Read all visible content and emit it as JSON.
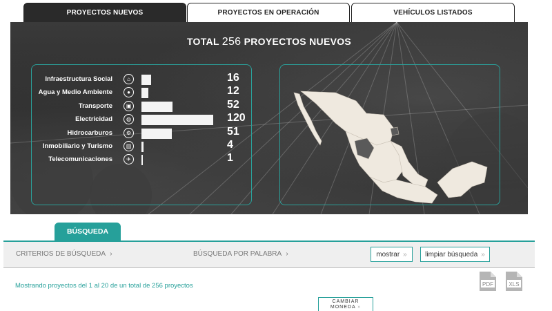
{
  "tabs": [
    {
      "label": "PROYECTOS NUEVOS",
      "active": true
    },
    {
      "label": "PROYECTOS EN OPERACIÓN",
      "active": false
    },
    {
      "label": "VEHÍCULOS LISTADOS",
      "active": false
    }
  ],
  "hero": {
    "title_prefix": "TOTAL",
    "total": "256",
    "title_suffix": "PROYECTOS NUEVOS"
  },
  "stats": [
    {
      "label": "Infraestructura Social",
      "value": 16,
      "icon": "hospital-icon",
      "glyph": "⌂"
    },
    {
      "label": "Agua y Medio Ambiente",
      "value": 12,
      "icon": "water-drop-icon",
      "glyph": "●"
    },
    {
      "label": "Transporte",
      "value": 52,
      "icon": "bus-icon",
      "glyph": "▣"
    },
    {
      "label": "Electricidad",
      "value": 120,
      "icon": "lightbulb-icon",
      "glyph": "◍"
    },
    {
      "label": "Hidrocarburos",
      "value": 51,
      "icon": "refinery-icon",
      "glyph": "⚙"
    },
    {
      "label": "Inmobiliario y Turismo",
      "value": 4,
      "icon": "building-icon",
      "glyph": "▥"
    },
    {
      "label": "Telecomunicaciones",
      "value": 1,
      "icon": "satellite-icon",
      "glyph": "✈"
    }
  ],
  "stats_max": 120,
  "search": {
    "tab_label": "BÚSQUEDA",
    "criteria_label": "CRITERIOS DE BÚSQUEDA",
    "byword_label": "BÚSQUEDA POR PALABRA",
    "show_label": "mostrar",
    "clear_label": "limpiar búsqueda"
  },
  "results": {
    "showing_text": "Mostrando proyectos del 1 al 20 de un total de 256 proyectos"
  },
  "downloads": {
    "pdf_label": "PDF",
    "xls_label": "XLS"
  },
  "currency": {
    "line1": "CAMBIAR",
    "line2": "MONEDA"
  },
  "colors": {
    "accent": "#26a09a",
    "hero_dark": "#2c2c2c",
    "map_land": "#efe9df"
  }
}
